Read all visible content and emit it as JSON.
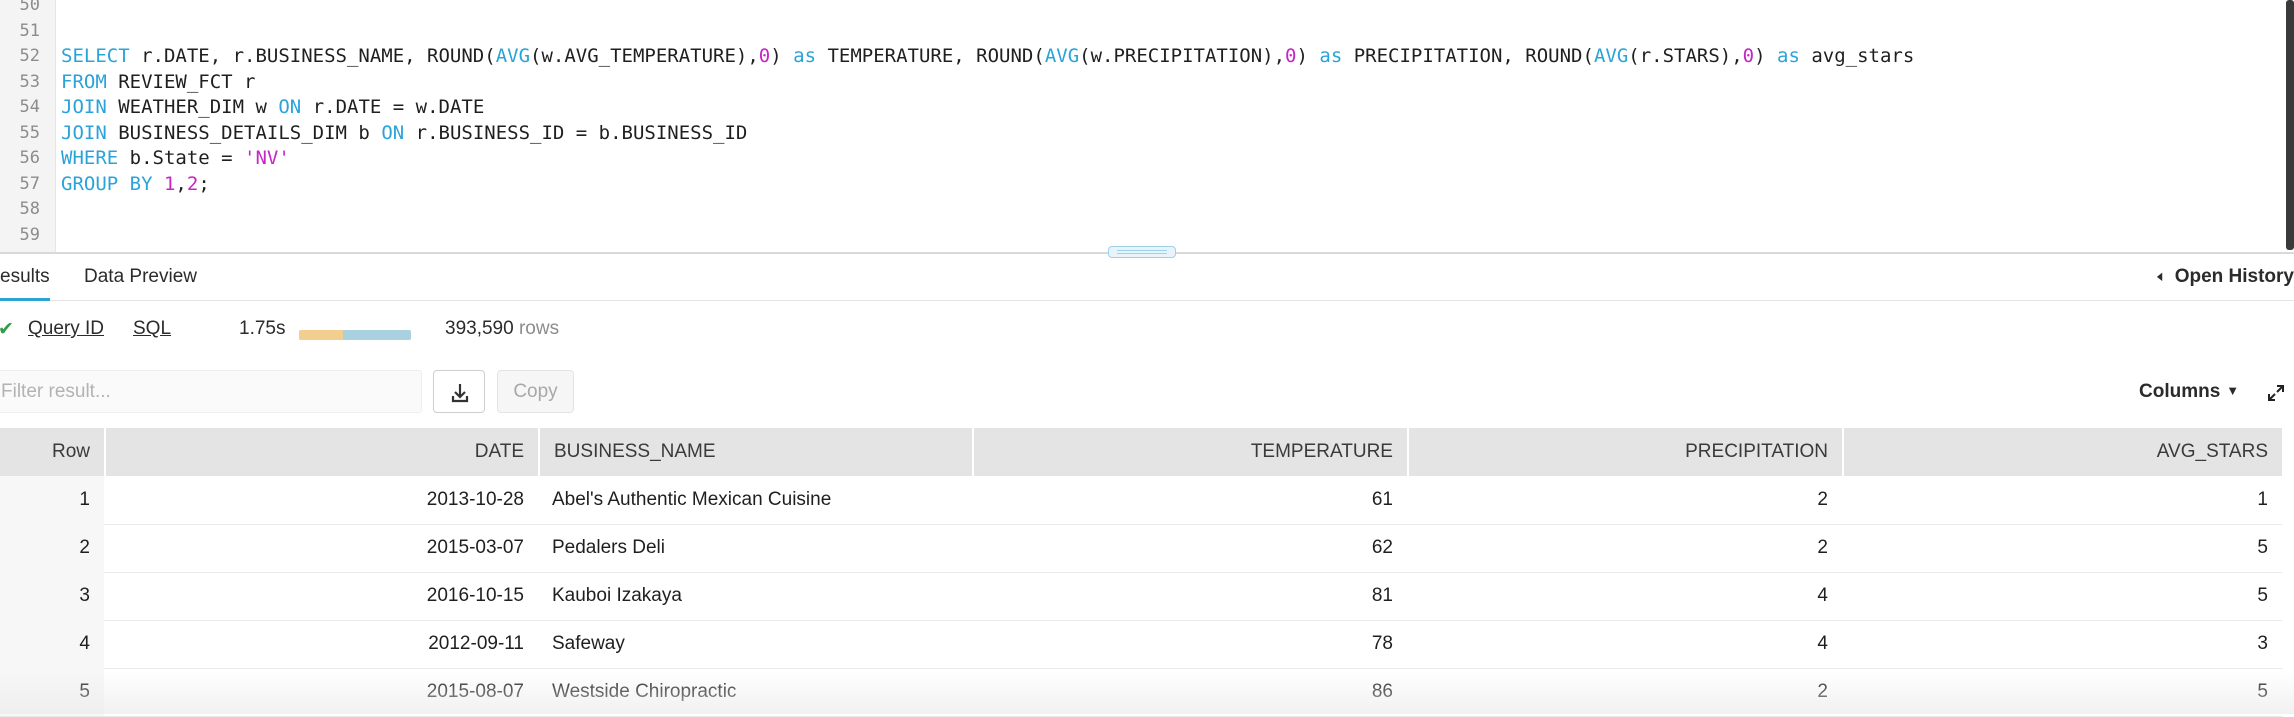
{
  "editor": {
    "lines": [
      {
        "num": "50",
        "tokens": []
      },
      {
        "num": "51",
        "tokens": []
      },
      {
        "num": "52",
        "tokens": [
          {
            "t": "kw",
            "v": "SELECT"
          },
          {
            "t": "",
            "v": " r.DATE, r.BUSINESS_NAME, ROUND("
          },
          {
            "t": "kw",
            "v": "AVG"
          },
          {
            "t": "",
            "v": "(w.AVG_TEMPERATURE),"
          },
          {
            "t": "num",
            "v": "0"
          },
          {
            "t": "",
            "v": ") "
          },
          {
            "t": "kw",
            "v": "as"
          },
          {
            "t": "",
            "v": " TEMPERATURE, ROUND("
          },
          {
            "t": "kw",
            "v": "AVG"
          },
          {
            "t": "",
            "v": "(w.PRECIPITATION),"
          },
          {
            "t": "num",
            "v": "0"
          },
          {
            "t": "",
            "v": ") "
          },
          {
            "t": "kw",
            "v": "as"
          },
          {
            "t": "",
            "v": " PRECIPITATION, ROUND("
          },
          {
            "t": "kw",
            "v": "AVG"
          },
          {
            "t": "",
            "v": "(r.STARS),"
          },
          {
            "t": "num",
            "v": "0"
          },
          {
            "t": "",
            "v": ") "
          },
          {
            "t": "kw",
            "v": "as"
          },
          {
            "t": "",
            "v": " avg_stars"
          }
        ]
      },
      {
        "num": "53",
        "tokens": [
          {
            "t": "kw",
            "v": "FROM"
          },
          {
            "t": "",
            "v": " REVIEW_FCT r"
          }
        ]
      },
      {
        "num": "54",
        "tokens": [
          {
            "t": "kw",
            "v": "JOIN"
          },
          {
            "t": "",
            "v": " WEATHER_DIM w "
          },
          {
            "t": "kw",
            "v": "ON"
          },
          {
            "t": "",
            "v": " r.DATE = w.DATE"
          }
        ]
      },
      {
        "num": "55",
        "tokens": [
          {
            "t": "kw",
            "v": "JOIN"
          },
          {
            "t": "",
            "v": " BUSINESS_DETAILS_DIM b "
          },
          {
            "t": "kw",
            "v": "ON"
          },
          {
            "t": "",
            "v": " r.BUSINESS_ID = b.BUSINESS_ID"
          }
        ]
      },
      {
        "num": "56",
        "tokens": [
          {
            "t": "kw",
            "v": "WHERE"
          },
          {
            "t": "",
            "v": " b.State = "
          },
          {
            "t": "str",
            "v": "'NV'"
          }
        ]
      },
      {
        "num": "57",
        "tokens": [
          {
            "t": "kw",
            "v": "GROUP BY"
          },
          {
            "t": "",
            "v": " "
          },
          {
            "t": "num",
            "v": "1"
          },
          {
            "t": "",
            "v": ","
          },
          {
            "t": "num",
            "v": "2"
          },
          {
            "t": "",
            "v": ";"
          }
        ]
      },
      {
        "num": "58",
        "tokens": []
      },
      {
        "num": "59",
        "tokens": []
      }
    ]
  },
  "tabs": {
    "results": "esults",
    "data_preview": "Data Preview",
    "open_history": "Open History"
  },
  "status": {
    "query_id": "Query ID",
    "sql": "SQL",
    "duration": "1.75s",
    "progress_compile_fraction": 0.39,
    "rows_count": "393,590",
    "rows_label": "rows"
  },
  "toolbar": {
    "filter_placeholder": "Filter result...",
    "copy_label": "Copy",
    "columns_label": "Columns"
  },
  "table": {
    "columns": [
      "Row",
      "DATE",
      "BUSINESS_NAME",
      "TEMPERATURE",
      "PRECIPITATION",
      "AVG_STARS"
    ],
    "rows": [
      [
        "1",
        "2013-10-28",
        "Abel's Authentic Mexican Cuisine",
        "61",
        "2",
        "1"
      ],
      [
        "2",
        "2015-03-07",
        "Pedalers Deli",
        "62",
        "2",
        "5"
      ],
      [
        "3",
        "2016-10-15",
        "Kauboi Izakaya",
        "81",
        "4",
        "5"
      ],
      [
        "4",
        "2012-09-11",
        "Safeway",
        "78",
        "4",
        "3"
      ],
      [
        "5",
        "2015-08-07",
        "Westside Chiropractic",
        "86",
        "2",
        "5"
      ]
    ]
  },
  "colors": {
    "accent": "#2aa3d8",
    "keyword": "#2aa3d8",
    "number": "#c526c5",
    "success": "#2e9e44",
    "bar_compile": "#f2cf91",
    "bar_execute": "#a9d1df"
  }
}
